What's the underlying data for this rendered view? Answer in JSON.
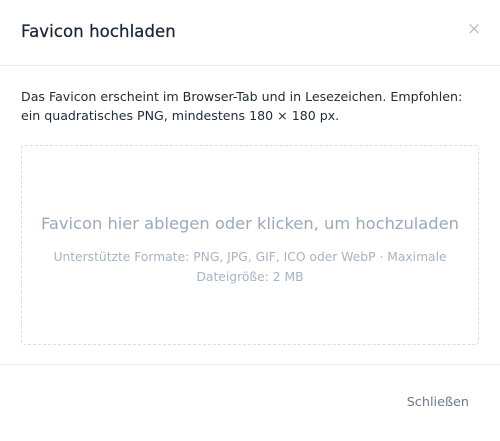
{
  "dialog": {
    "title": "Favicon hochladen",
    "close_symbol": "×",
    "close_icon": "close-icon"
  },
  "body": {
    "description": "Das Favicon erscheint im Browser-Tab und in Lesezeichen. Empfohlen: ein quadratisches PNG, mindestens 180 × 180 px.",
    "dropzone": {
      "title": "Favicon hier ablegen oder klicken, um hochzuladen",
      "hint": "Unterstützte Formate: PNG, JPG, GIF, ICO oder WebP · Maximale Dateigröße: 2 MB"
    }
  },
  "footer": {
    "close_label": "Schließen"
  },
  "colors": {
    "title": "#1a2636",
    "text": "#1f2a37",
    "muted": "#9aa9bd",
    "border": "#e9eef3",
    "dashed_border": "#d5dde6",
    "footer_button": "#6b7a8c"
  }
}
